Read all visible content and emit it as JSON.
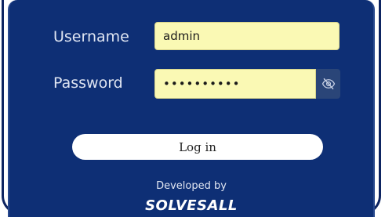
{
  "login": {
    "username_label": "Username",
    "username_value": "admin",
    "password_label": "Password",
    "password_masked": "••••••••••",
    "login_label": "Log in"
  },
  "footer": {
    "developed_by": "Developed by",
    "brand": "SOLVESALL"
  },
  "icons": {
    "password_toggle": "eye-slash-icon"
  },
  "colors": {
    "panel_background": "#0e2f75",
    "input_background": "#faf9b4",
    "button_background": "#ffffff"
  }
}
